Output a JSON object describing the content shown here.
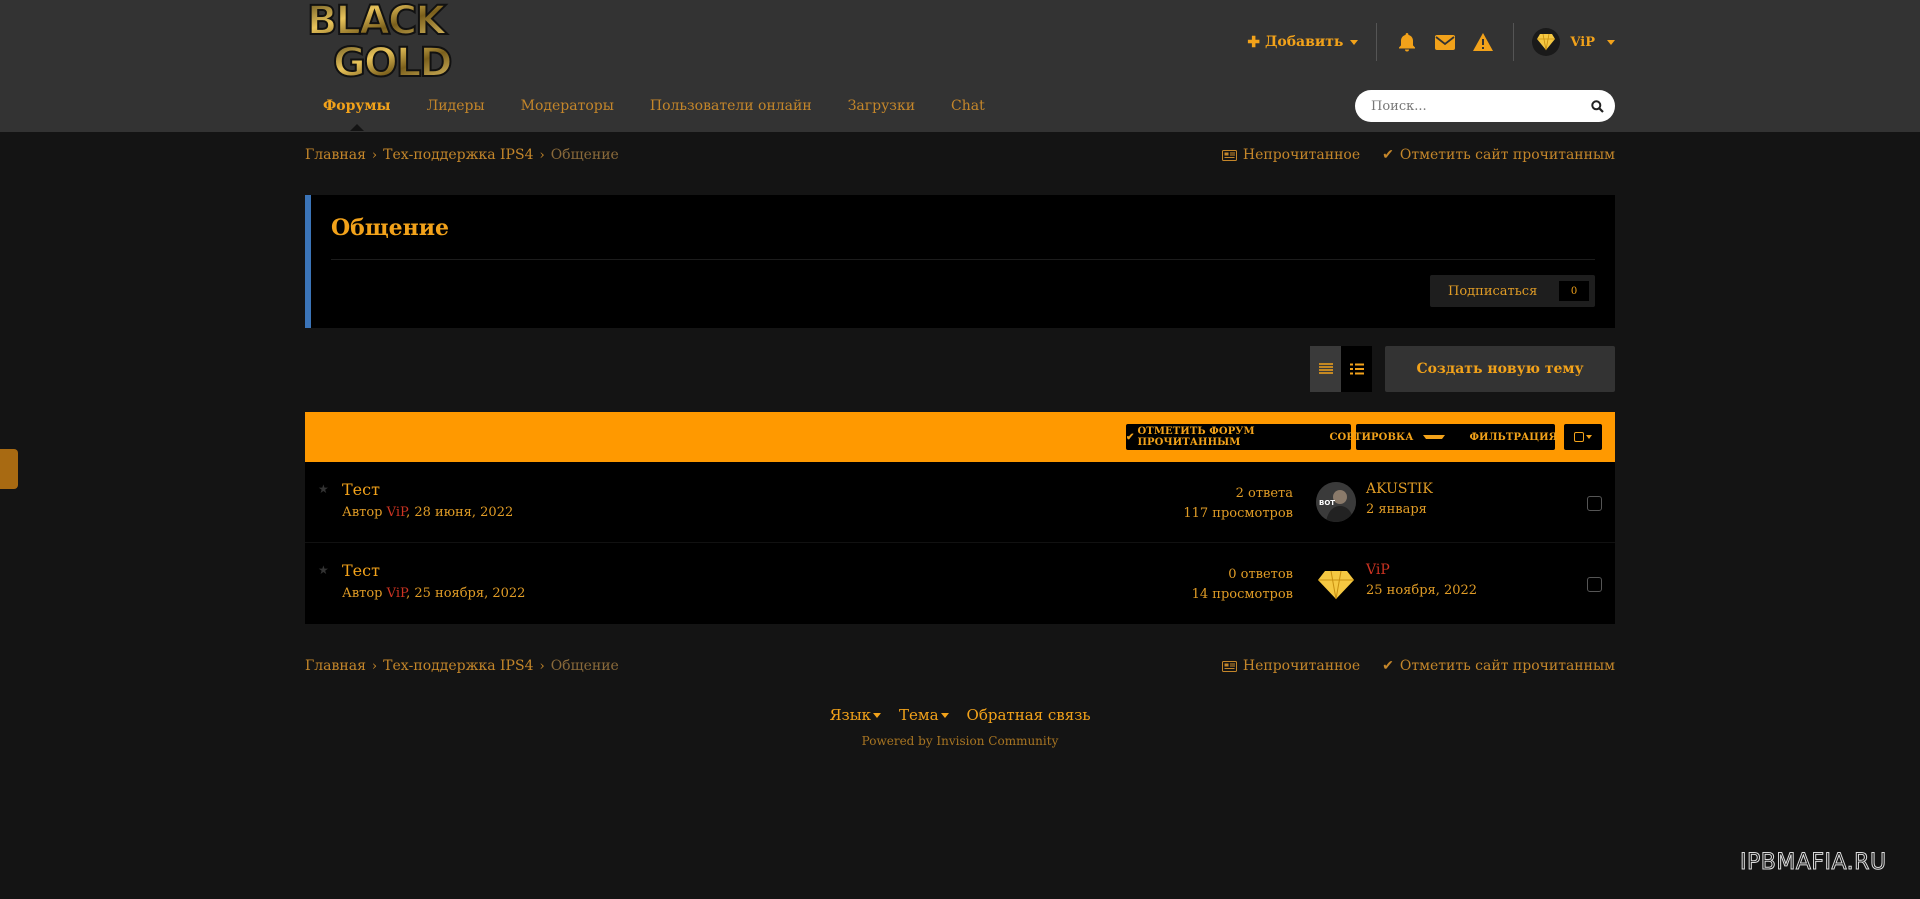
{
  "colors": {
    "accent": "#f2a21a",
    "header_bg": "#333333",
    "page_bg": "#141414",
    "table_bar": "#ff9900",
    "forum_border": "#3b74b8",
    "author_red": "#cc3322"
  },
  "logo": {
    "line1": "BLACK",
    "line2": "GOLD"
  },
  "user_bar": {
    "add_label": "Добавить",
    "icons": [
      "bell-icon",
      "envelope-icon",
      "warning-icon"
    ],
    "user_name": "ViP"
  },
  "nav": {
    "items": [
      {
        "label": "Форумы",
        "active": true
      },
      {
        "label": "Лидеры"
      },
      {
        "label": "Модераторы"
      },
      {
        "label": "Пользователи онлайн"
      },
      {
        "label": "Загрузки"
      },
      {
        "label": "Chat"
      }
    ]
  },
  "search": {
    "placeholder": "Поиск..."
  },
  "breadcrumb": {
    "items": [
      "Главная",
      "Тех-поддержка IPS4",
      "Общение"
    ],
    "unread": "Непрочитанное",
    "mark_site_read": "Отметить сайт прочитанным"
  },
  "forum": {
    "title": "Общение",
    "follow_label": "Подписаться",
    "follow_count": "0"
  },
  "toolbar": {
    "new_topic": "Создать новую тему",
    "mark_forum_read": "ОТМЕТИТЬ ФОРУМ ПРОЧИТАННЫМ",
    "sort": "СОРТИРОВКА",
    "filter": "ФИЛЬТРАЦИЯ"
  },
  "topics": [
    {
      "title": "Тест",
      "author_prefix": "Автор",
      "author": "ViP",
      "date": ", 28 июня, 2022",
      "replies": "2 ответа",
      "views": "117 просмотров",
      "last_user": "AKUSTIK",
      "last_date": "2 января"
    },
    {
      "title": "Тест",
      "author_prefix": "Автор",
      "author": "ViP",
      "date": ", 25 ноября, 2022",
      "replies": "0 ответов",
      "views": "14 просмотров",
      "last_user": "ViP",
      "last_date": "25 ноября, 2022"
    }
  ],
  "footer": {
    "language": "Язык",
    "theme": "Тема",
    "feedback": "Обратная связь",
    "powered": "Powered by Invision Community"
  },
  "watermark": "IPBMAFIA.RU"
}
